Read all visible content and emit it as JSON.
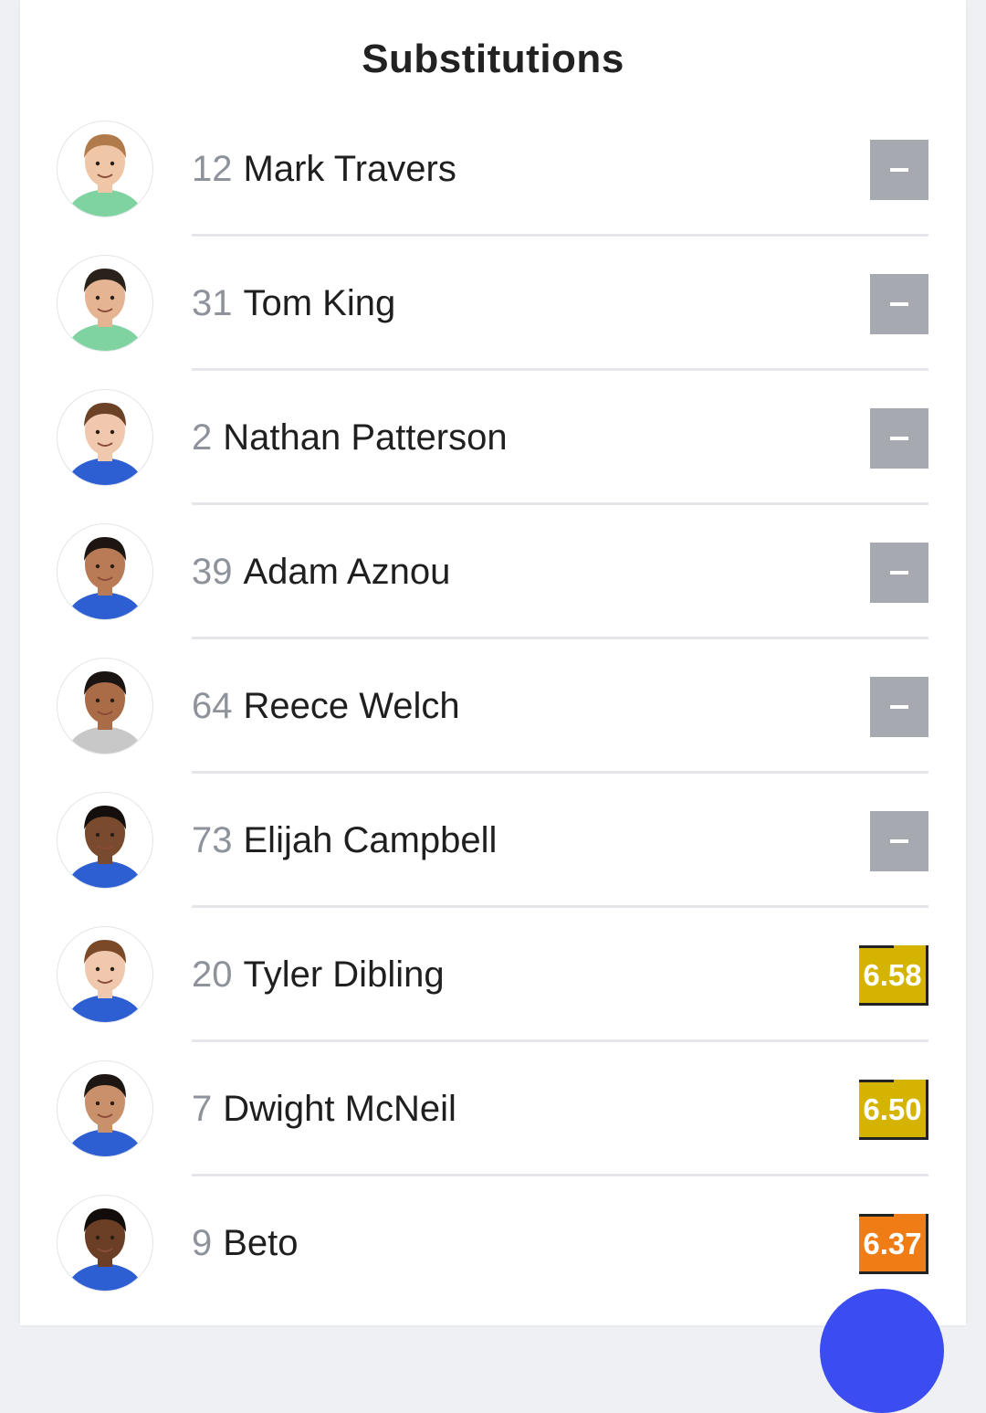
{
  "section": {
    "title": "Substitutions"
  },
  "players": [
    {
      "number": "12",
      "name": "Mark Travers",
      "rating": "",
      "rating_color": "",
      "kit": "#7fd3a0",
      "skin": "#efc6a6",
      "hair": "#b07a4a"
    },
    {
      "number": "31",
      "name": "Tom King",
      "rating": "",
      "rating_color": "",
      "kit": "#7fd3a0",
      "skin": "#e5b493",
      "hair": "#2a211b"
    },
    {
      "number": "2",
      "name": "Nathan Patterson",
      "rating": "",
      "rating_color": "",
      "kit": "#2d5fd3",
      "skin": "#f0c8ad",
      "hair": "#6b4226"
    },
    {
      "number": "39",
      "name": "Adam Aznou",
      "rating": "",
      "rating_color": "",
      "kit": "#2d5fd3",
      "skin": "#b97b55",
      "hair": "#1c1512"
    },
    {
      "number": "64",
      "name": "Reece Welch",
      "rating": "",
      "rating_color": "",
      "kit": "#c8c8c8",
      "skin": "#a96c47",
      "hair": "#1a1412"
    },
    {
      "number": "73",
      "name": "Elijah Campbell",
      "rating": "",
      "rating_color": "",
      "kit": "#2d5fd3",
      "skin": "#7a4a2e",
      "hair": "#140f0c"
    },
    {
      "number": "20",
      "name": "Tyler Dibling",
      "rating": "6.58",
      "rating_color": "#d4b400",
      "kit": "#2d5fd3",
      "skin": "#f0c8ad",
      "hair": "#7a4a28"
    },
    {
      "number": "7",
      "name": "Dwight McNeil",
      "rating": "6.50",
      "rating_color": "#d4b400",
      "kit": "#2d5fd3",
      "skin": "#c9916b",
      "hair": "#1d1612"
    },
    {
      "number": "9",
      "name": "Beto",
      "rating": "6.37",
      "rating_color": "#ef7c14",
      "kit": "#2d5fd3",
      "skin": "#6b3f26",
      "hair": "#120d0a"
    }
  ],
  "icons": {
    "no_rating": "dash-icon",
    "fab": "action-button"
  },
  "colors": {
    "no_rating_bg": "#a7a9b1",
    "rating_yellow": "#d4b400",
    "rating_orange": "#ef7c14",
    "fab": "#3b4df0"
  }
}
